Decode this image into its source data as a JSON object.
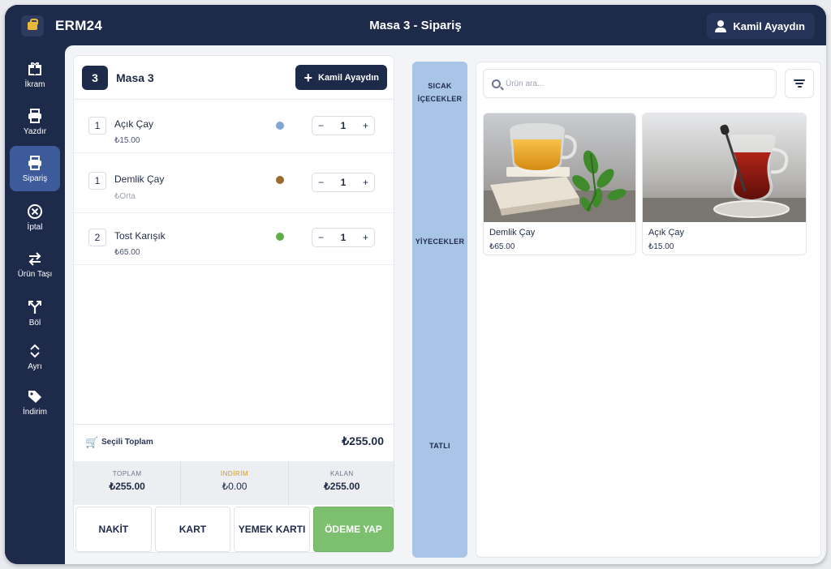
{
  "app": {
    "brand": "ERM24",
    "title": "Masa 3 - Sipariş",
    "user": "Kamil Ayaydın"
  },
  "sidebar": {
    "items": [
      {
        "label": "İkram",
        "icon": "gift-icon",
        "active": false
      },
      {
        "label": "Yazdır",
        "icon": "printer-icon",
        "active": false
      },
      {
        "label": "Sipariş",
        "icon": "printer-icon",
        "active": true
      },
      {
        "label": "İptal",
        "icon": "cancel-icon",
        "active": false
      },
      {
        "label": "Ürün Taşı",
        "icon": "transfer-icon",
        "active": false
      },
      {
        "label": "Böl",
        "icon": "split-icon",
        "active": false
      },
      {
        "label": "Ayrı",
        "icon": "expand-icon",
        "active": false
      },
      {
        "label": "İndirim",
        "icon": "tag-icon",
        "active": false
      }
    ]
  },
  "order": {
    "table_number": "3",
    "table_name": "Masa 3",
    "waiter_button": "Kamil Ayaydın",
    "items": [
      {
        "qty": "1",
        "name": "Açık Çay",
        "price": "₺15.00",
        "dot_color": "#7fa6d4",
        "count": "1"
      },
      {
        "qty": "1",
        "name": "Demlik Çay",
        "price": "₺Orta",
        "dot_color": "#9a6a2e",
        "count": "1"
      },
      {
        "qty": "2",
        "name": "Tost Karışık",
        "price": "₺65.00",
        "dot_color": "#5fae4b",
        "count": "1"
      }
    ],
    "selected_total_label": "Seçili Toplam",
    "selected_total": "₺255.00",
    "summary": {
      "total_label": "TOPLAM",
      "total": "₺255.00",
      "discount_label": "İNDİRİM",
      "discount": "₺0.00",
      "remaining_label": "KALAN",
      "remaining": "₺255.00"
    },
    "payment": {
      "cash": "NAKİT",
      "card": "KART",
      "meal_card": "YEMEK KARTI",
      "pay": "ÖDEME YAP"
    }
  },
  "categories": [
    {
      "line1": "SICAK",
      "line2": "İÇECEKLER"
    },
    {
      "line1": "YİYECEKLER",
      "line2": ""
    },
    {
      "line1": "TATLI",
      "line2": ""
    }
  ],
  "products": {
    "search_placeholder": "Ürün ara...",
    "items": [
      {
        "name": "Demlik Çay",
        "price": "₺65.00"
      },
      {
        "name": "Açık Çay",
        "price": "₺15.00"
      }
    ]
  }
}
